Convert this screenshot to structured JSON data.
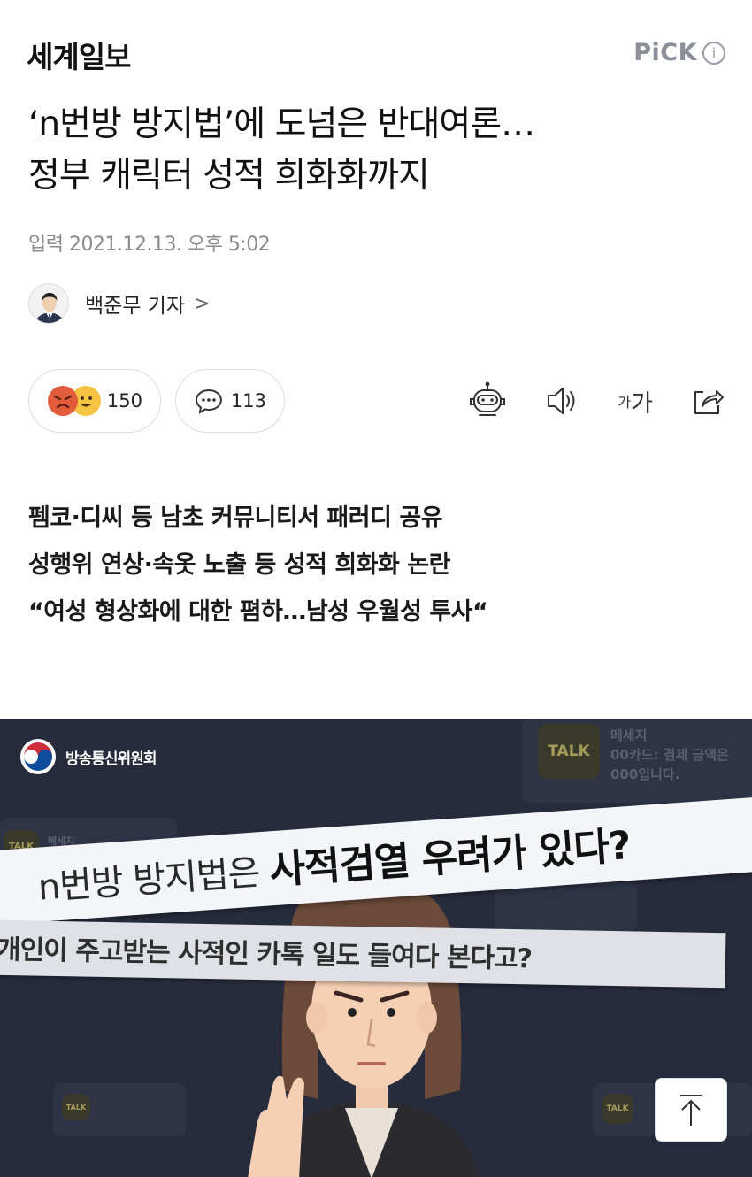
{
  "header": {
    "logo": "세계일보",
    "pick_label": "PiCK",
    "pick_info": "i"
  },
  "article": {
    "headline_lines": [
      "‘n번방 방지법’에 도넘은 반대여론…",
      "정부 캐릭터 성적 희화화까지"
    ],
    "date": "입력 2021.12.13. 오후 5:02",
    "reporter": "백준무 기자",
    "reporter_chevron": ">",
    "subheads": [
      "펨코·디씨 등 남초 커뮤니티서 패러디 공유",
      "성행위 연상·속옷 노출 등 성적 희화화 논란",
      "“여성 형상화에 대한 폄하…남성 우월성 투사“"
    ]
  },
  "reactions": {
    "emoji_count": "150",
    "comment_count": "113"
  },
  "tools": {
    "font_small": "가",
    "font_large": "가"
  },
  "image": {
    "org": "방송통신위원회",
    "talk_label": "TALK",
    "ghost_message_title": "메세지",
    "ghost_message_lines": [
      "00카드: 결제 금액은",
      "000입니다."
    ],
    "banner_main_prefix": "n번방 방지법은 ",
    "banner_main_bold": "사적검열 우려가 있다?",
    "banner_sub": "개인이 주고받는 사적인 카톡      일도 들여다 본다고?"
  },
  "colors": {
    "photo_bg": "#272c3d",
    "pick_gray": "#8a8f98",
    "date_gray": "#8a8a8a",
    "angry_emoji": "#e25b3b",
    "happy_emoji": "#f6c443"
  }
}
